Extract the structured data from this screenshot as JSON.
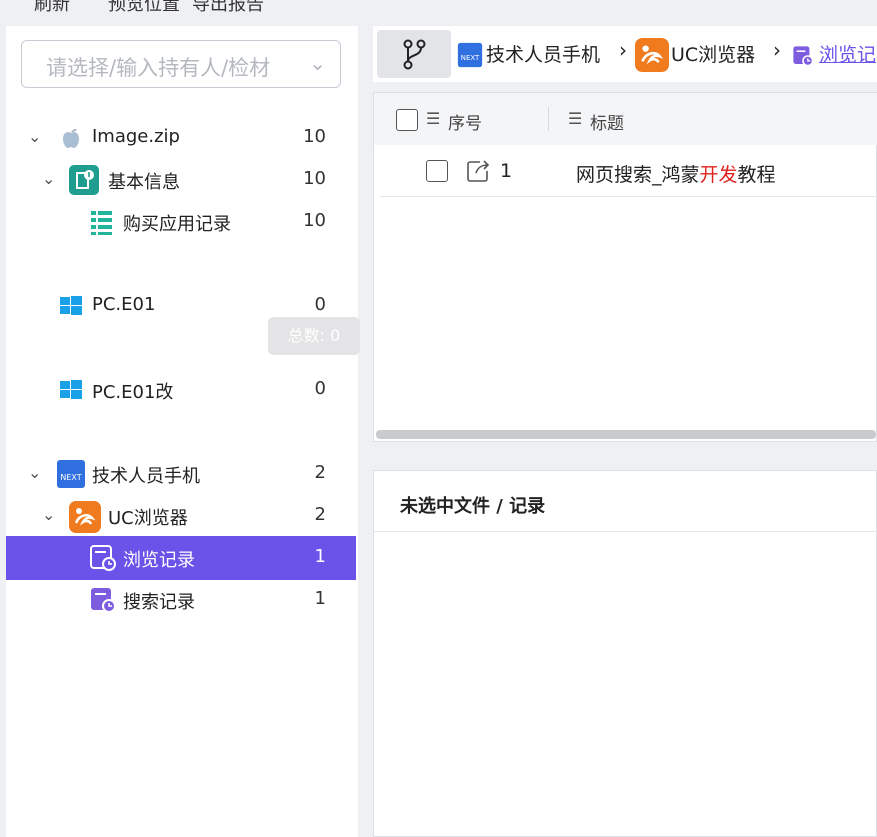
{
  "toolbar": {
    "items": [
      "刷新",
      "预览位置",
      "导出报告"
    ]
  },
  "sidebar": {
    "filter_placeholder": "请选择/输入持有人/检材",
    "tree": [
      {
        "label": "Image.zip",
        "count": "10",
        "icon": "apple-icon"
      },
      {
        "label": "基本信息",
        "count": "10",
        "icon": "basic-info-icon"
      },
      {
        "label": "购买应用记录",
        "count": "10",
        "icon": "list-icon"
      },
      {
        "label": "PC.E01",
        "count": "0",
        "icon": "windows-icon"
      },
      {
        "label": "PC.E01改",
        "count": "0",
        "icon": "windows-icon"
      },
      {
        "label": "技术人员手机",
        "count": "2",
        "icon": "phone-next-icon"
      },
      {
        "label": "UC浏览器",
        "count": "2",
        "icon": "uc-browser-icon"
      },
      {
        "label": "浏览记录",
        "count": "1",
        "icon": "history-icon",
        "selected": true
      },
      {
        "label": "搜索记录",
        "count": "1",
        "icon": "history-icon"
      }
    ],
    "tooltip": "总数: 0"
  },
  "breadcrumb": {
    "items": [
      "技术人员手机",
      "UC浏览器",
      "浏览记"
    ]
  },
  "table": {
    "columns": [
      "序号",
      "标题"
    ],
    "rows": [
      {
        "index": "1",
        "title_parts": [
          "网页搜索_鸿蒙",
          "开发",
          "教程"
        ],
        "highlight_color": "#e0201f"
      }
    ]
  },
  "detail": {
    "title": "未选中文件 / 记录"
  },
  "colors": {
    "accent": "#6b52e8",
    "highlight": "#e0201f"
  }
}
